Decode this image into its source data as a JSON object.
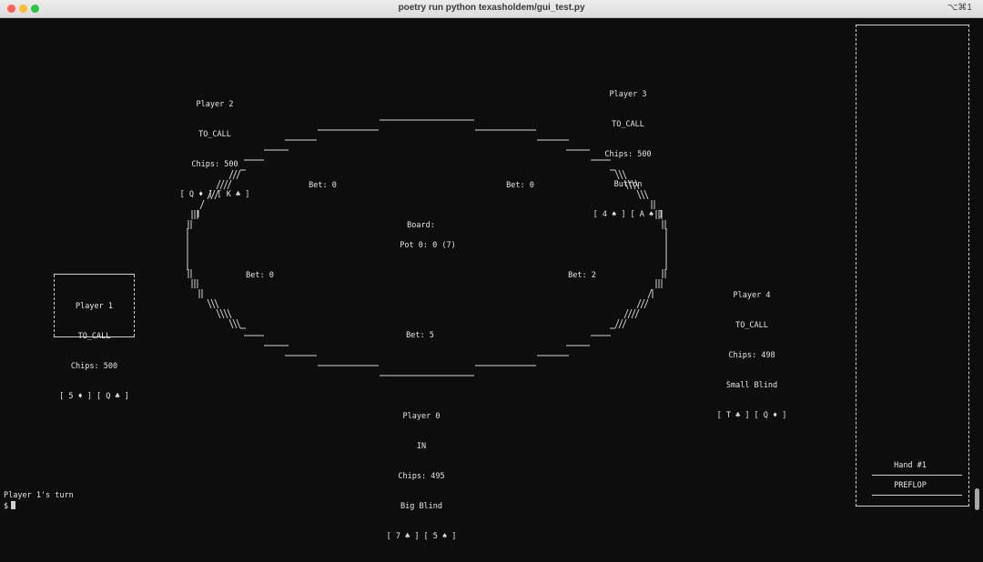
{
  "window": {
    "title": "poetry run python texasholdem/gui_test.py",
    "shortcut": "⌥⌘1",
    "traffic_lights": [
      "#ff5f57",
      "#febc2e",
      "#28c840"
    ]
  },
  "table": {
    "board_label": "Board:",
    "pot": "Pot 0: 0 (7)",
    "bets": {
      "player2": "Bet: 0",
      "player3": "Bet: 0",
      "player1": "Bet: 0",
      "player4": "Bet: 2",
      "player0": "Bet: 5"
    }
  },
  "players": {
    "p0": {
      "name": "Player 0",
      "status": "IN",
      "chips": "Chips: 495",
      "role": "Big Blind",
      "cards": "[ 7 ♣ ] [ 5 ♠ ]"
    },
    "p1": {
      "name": "Player 1",
      "status": "TO_CALL",
      "chips": "Chips: 500",
      "cards": "[ 5 ♦ ] [ Q ♣ ]"
    },
    "p2": {
      "name": "Player 2",
      "status": "TO_CALL",
      "chips": "Chips: 500",
      "cards": "[ Q ♦ ] [ K ♣ ]"
    },
    "p3": {
      "name": "Player 3",
      "status": "TO_CALL",
      "chips": "Chips: 500",
      "role": "Button",
      "cards": "[ 4 ♠ ] [ A ♠ ]"
    },
    "p4": {
      "name": "Player 4",
      "status": "TO_CALL",
      "chips": "Chips: 498",
      "role": "Small Blind",
      "cards": "[ T ♣ ] [ Q ♦ ]"
    }
  },
  "panel": {
    "hand": "Hand #1",
    "stage": "PREFLOP"
  },
  "prompt": {
    "turn": "Player 1's turn",
    "symbol": "$"
  }
}
